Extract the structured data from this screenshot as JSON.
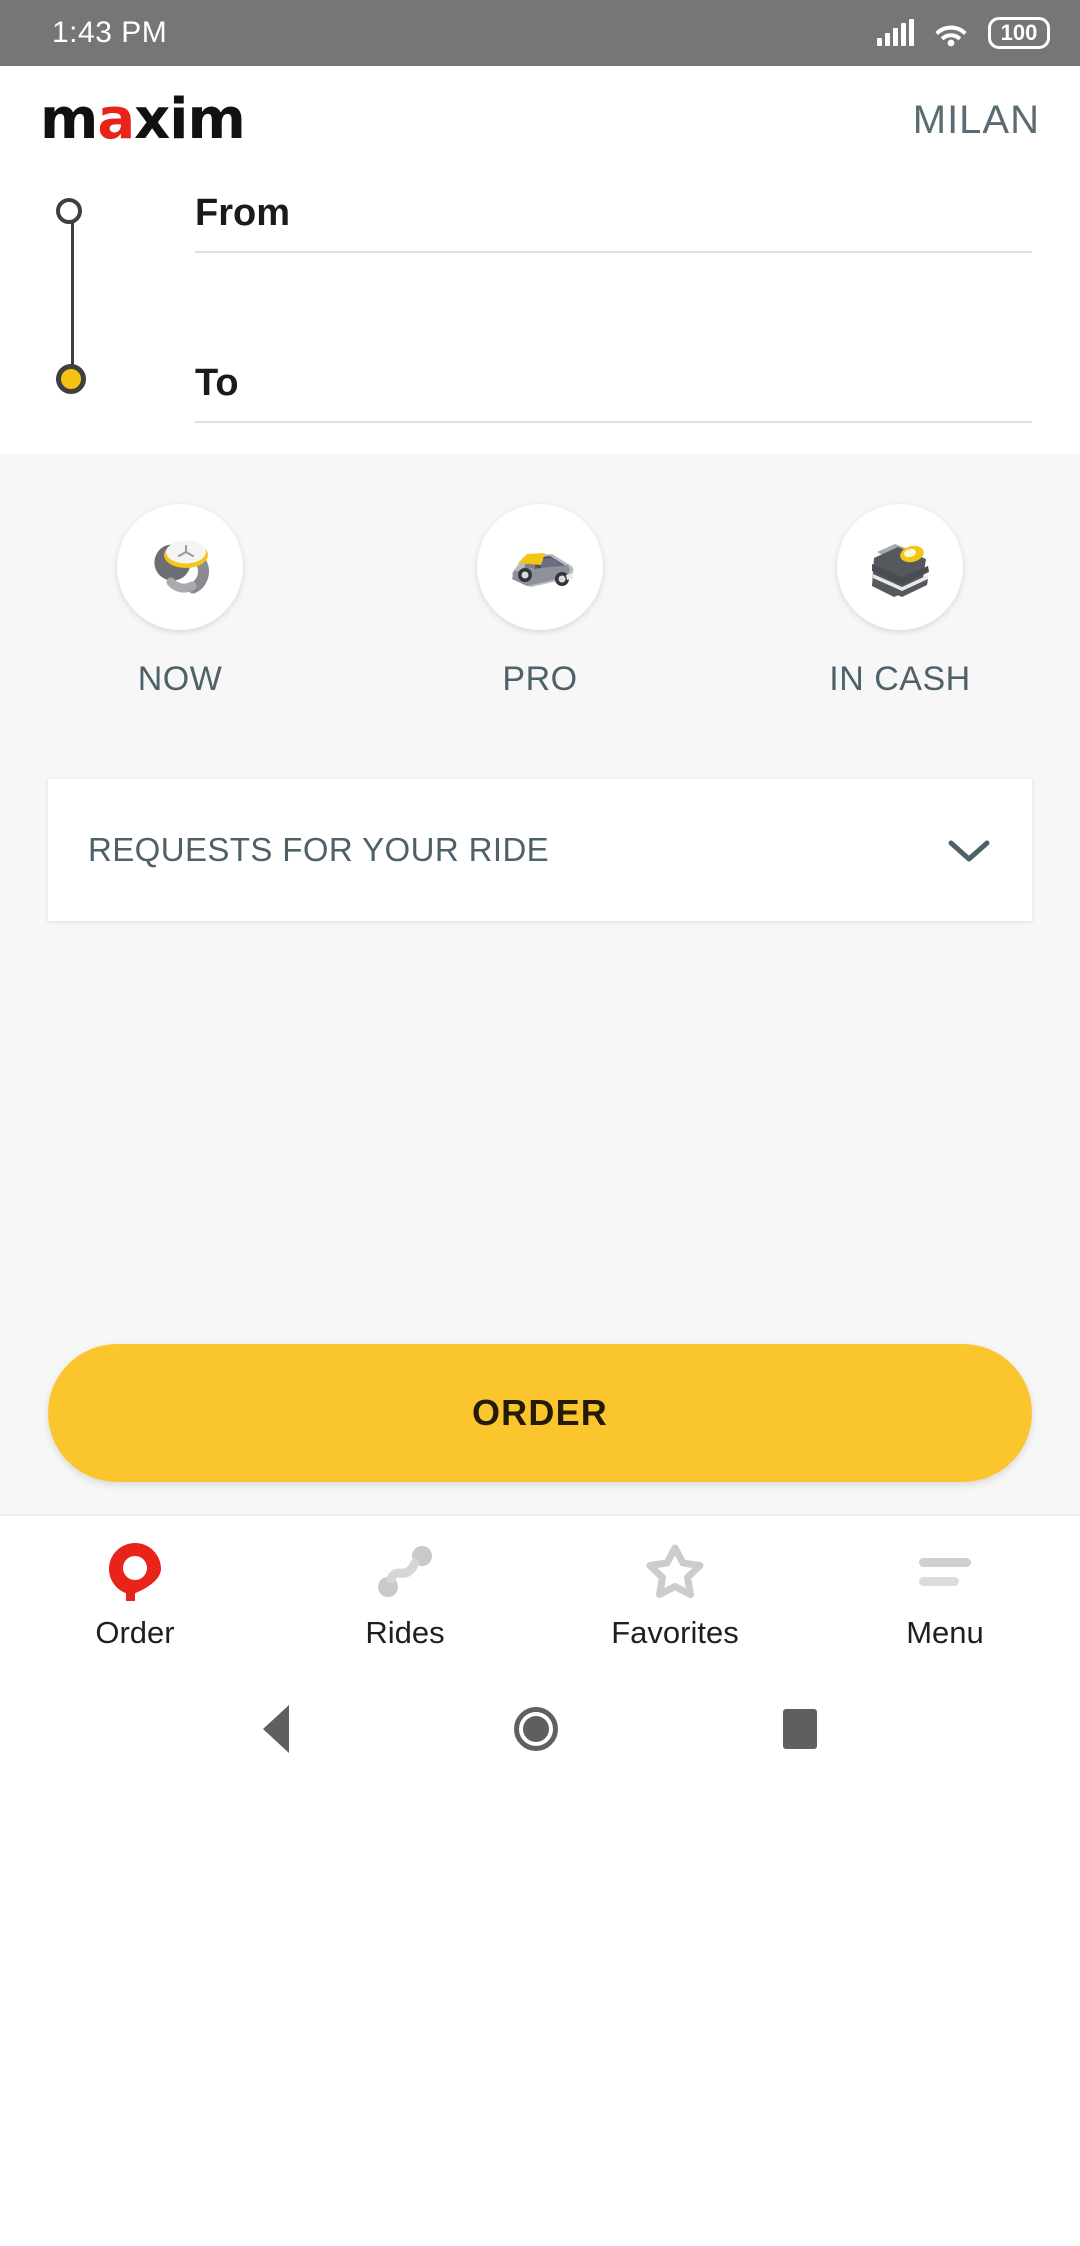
{
  "status_bar": {
    "time": "1:43 PM",
    "battery_level": "100",
    "signal_icon": "signal-bars-icon",
    "wifi_icon": "wifi-icon",
    "battery_icon": "battery-icon"
  },
  "header": {
    "logo_part1": "m",
    "logo_accent": "a",
    "logo_part2": "xim",
    "city": "MILAN"
  },
  "route": {
    "from_label": "From",
    "from_value": "",
    "to_label": "To",
    "to_value": "",
    "from_marker_icon": "origin-dot-icon",
    "to_marker_icon": "destination-dot-icon"
  },
  "services": [
    {
      "id": "now",
      "label": "NOW",
      "icon": "wristwatch-icon"
    },
    {
      "id": "pro",
      "label": "PRO",
      "icon": "car-icon"
    },
    {
      "id": "in-cash",
      "label": "IN CASH",
      "icon": "wallet-icon"
    }
  ],
  "requests": {
    "label": "REQUESTS FOR YOUR RIDE",
    "expander_icon": "chevron-down-icon"
  },
  "order": {
    "label": "ORDER"
  },
  "bottom_nav": [
    {
      "id": "order",
      "label": "Order",
      "icon": "maxim-pin-icon",
      "active": true
    },
    {
      "id": "rides",
      "label": "Rides",
      "icon": "route-icon",
      "active": false
    },
    {
      "id": "favorites",
      "label": "Favorites",
      "icon": "star-outline-icon",
      "active": false
    },
    {
      "id": "menu",
      "label": "Menu",
      "icon": "hamburger-icon",
      "active": false
    }
  ],
  "system_nav": {
    "back_icon": "back-triangle-icon",
    "home_icon": "home-circle-icon",
    "recents_icon": "recents-square-icon"
  },
  "colors": {
    "brand_red": "#e8231a",
    "brand_yellow": "#fbc62d",
    "marker_yellow": "#f6c212",
    "slate_text": "#4e6068",
    "status_bar_bg": "#767676",
    "panel_bg": "#f7f7f7"
  }
}
